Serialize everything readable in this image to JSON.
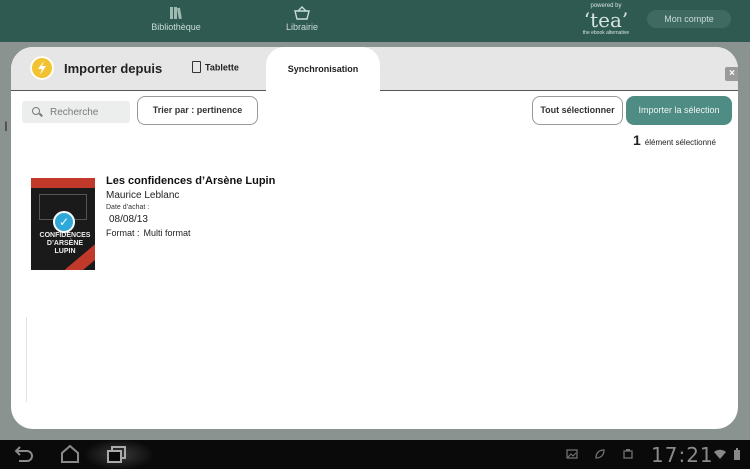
{
  "app": {
    "nav": [
      {
        "label": "Bibliothèque",
        "icon": "books-icon"
      },
      {
        "label": "Librairie",
        "icon": "basket-icon"
      }
    ],
    "brand": {
      "powered_by": "powered by",
      "name": "‘tea’",
      "tagline": "the ebook alternative"
    },
    "account_label": "Mon compte",
    "bg_letter": "I"
  },
  "modal": {
    "title": "Importer depuis",
    "tabs": [
      {
        "label": "Tablette",
        "icon": "tablet-icon",
        "active": false
      },
      {
        "label": "Synchronisation",
        "active": true
      }
    ],
    "close_label": "×",
    "search": {
      "placeholder": "Recherche"
    },
    "sort_label": "Trier par : pertinence",
    "select_all_label": "Tout sélectionner",
    "import_label": "Importer la sélection",
    "selection": {
      "count": "1",
      "label": "élément sélectionné"
    },
    "books": [
      {
        "title": "Les confidences d’Arsène Lupin",
        "author": "Maurice Leblanc",
        "date_label": "Date d’achat :",
        "date": "08/08/13",
        "format_label": "Format :",
        "format": "Multi format",
        "cover_text": "LES CONFIDENCES D’ARSÈNE LUPIN",
        "selected": true
      }
    ]
  },
  "status_bar": {
    "time": "17:21"
  },
  "colors": {
    "accent": "#4f8c83",
    "topbar": "#2f5a52",
    "check": "#2da8d8",
    "icon_yellow": "#f1c232"
  }
}
